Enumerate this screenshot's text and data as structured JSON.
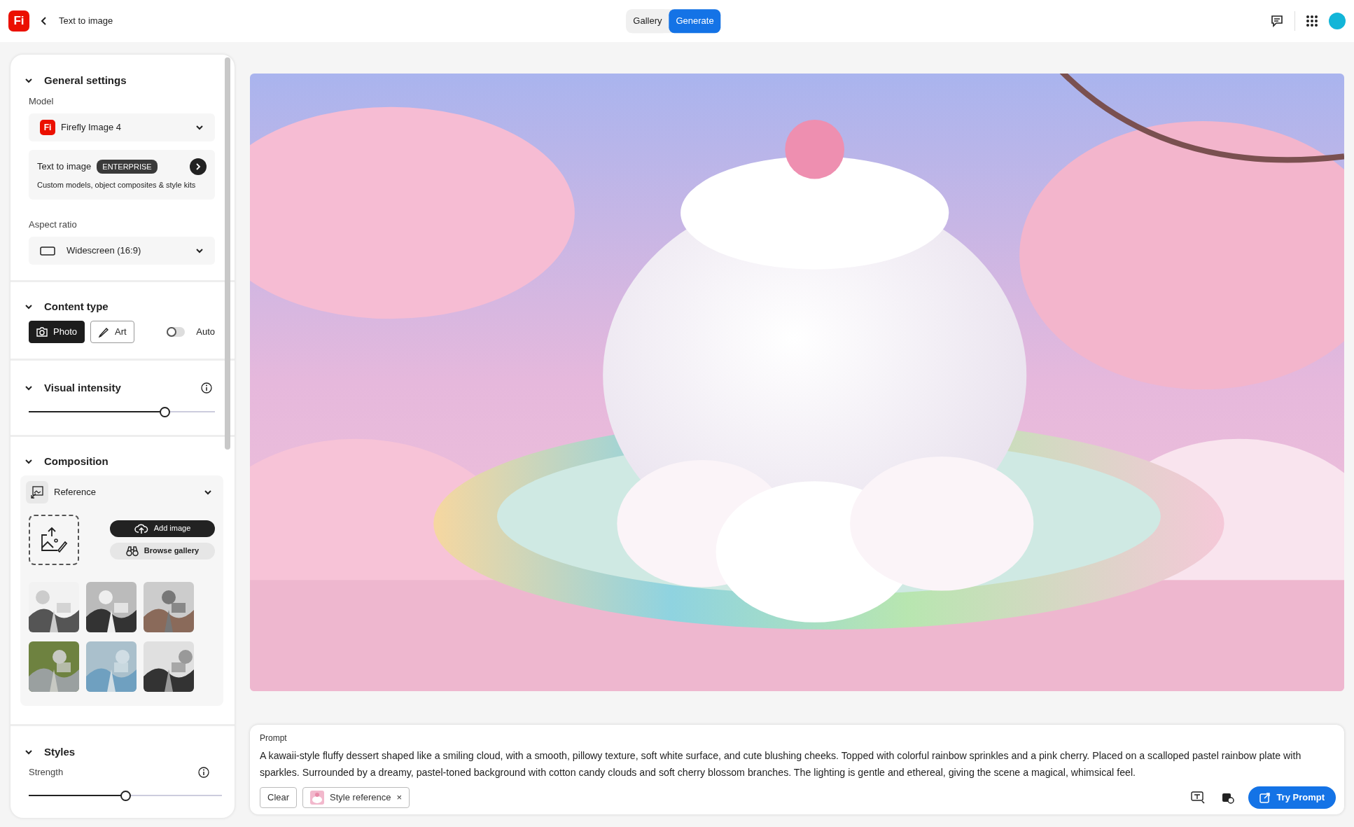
{
  "header": {
    "logo": "Fi",
    "title": "Text to image",
    "tabs": [
      {
        "label": "Gallery",
        "selected": false
      },
      {
        "label": "Generate",
        "selected": true
      }
    ]
  },
  "sidebar": {
    "general": {
      "title": "General settings",
      "model_label": "Model",
      "model_badge": "Fi",
      "model": "Firefly Image 4",
      "promo_title": "Text to image",
      "promo_badge": "ENTERPRISE",
      "promo_text": "Custom models, object composites & style kits",
      "aspect_label": "Aspect ratio",
      "aspect": "Widescreen (16:9)"
    },
    "content_type": {
      "title": "Content type",
      "options": [
        {
          "label": "Photo",
          "selected": true
        },
        {
          "kind": "art",
          "label": "Art",
          "selected": false
        }
      ],
      "auto": {
        "label": "Auto",
        "on": false
      }
    },
    "visual_intensity": {
      "title": "Visual intensity",
      "level": 0.73
    },
    "composition": {
      "title": "Composition",
      "reference": "Reference",
      "add_image": "Add image",
      "browse_gallery": "Browse gallery"
    },
    "styles": {
      "title": "Styles",
      "strength_label": "Strength",
      "level": 0.5
    }
  },
  "prompt": {
    "label": "Prompt",
    "text": "A kawaii-style fluffy dessert shaped like a smiling cloud, with a smooth, pillowy texture, soft white surface, and cute blushing cheeks. Topped with colorful rainbow sprinkles and a pink cherry. Placed on a scalloped pastel rainbow plate with sparkles. Surrounded by a dreamy, pastel-toned background with cotton candy clouds and soft cherry blossom branches. The lighting is gentle and ethereal, giving the scene a magical, whimsical feel.",
    "clear": "Clear",
    "chip": "Style reference",
    "chip_close": "×",
    "try": "Try Prompt"
  }
}
